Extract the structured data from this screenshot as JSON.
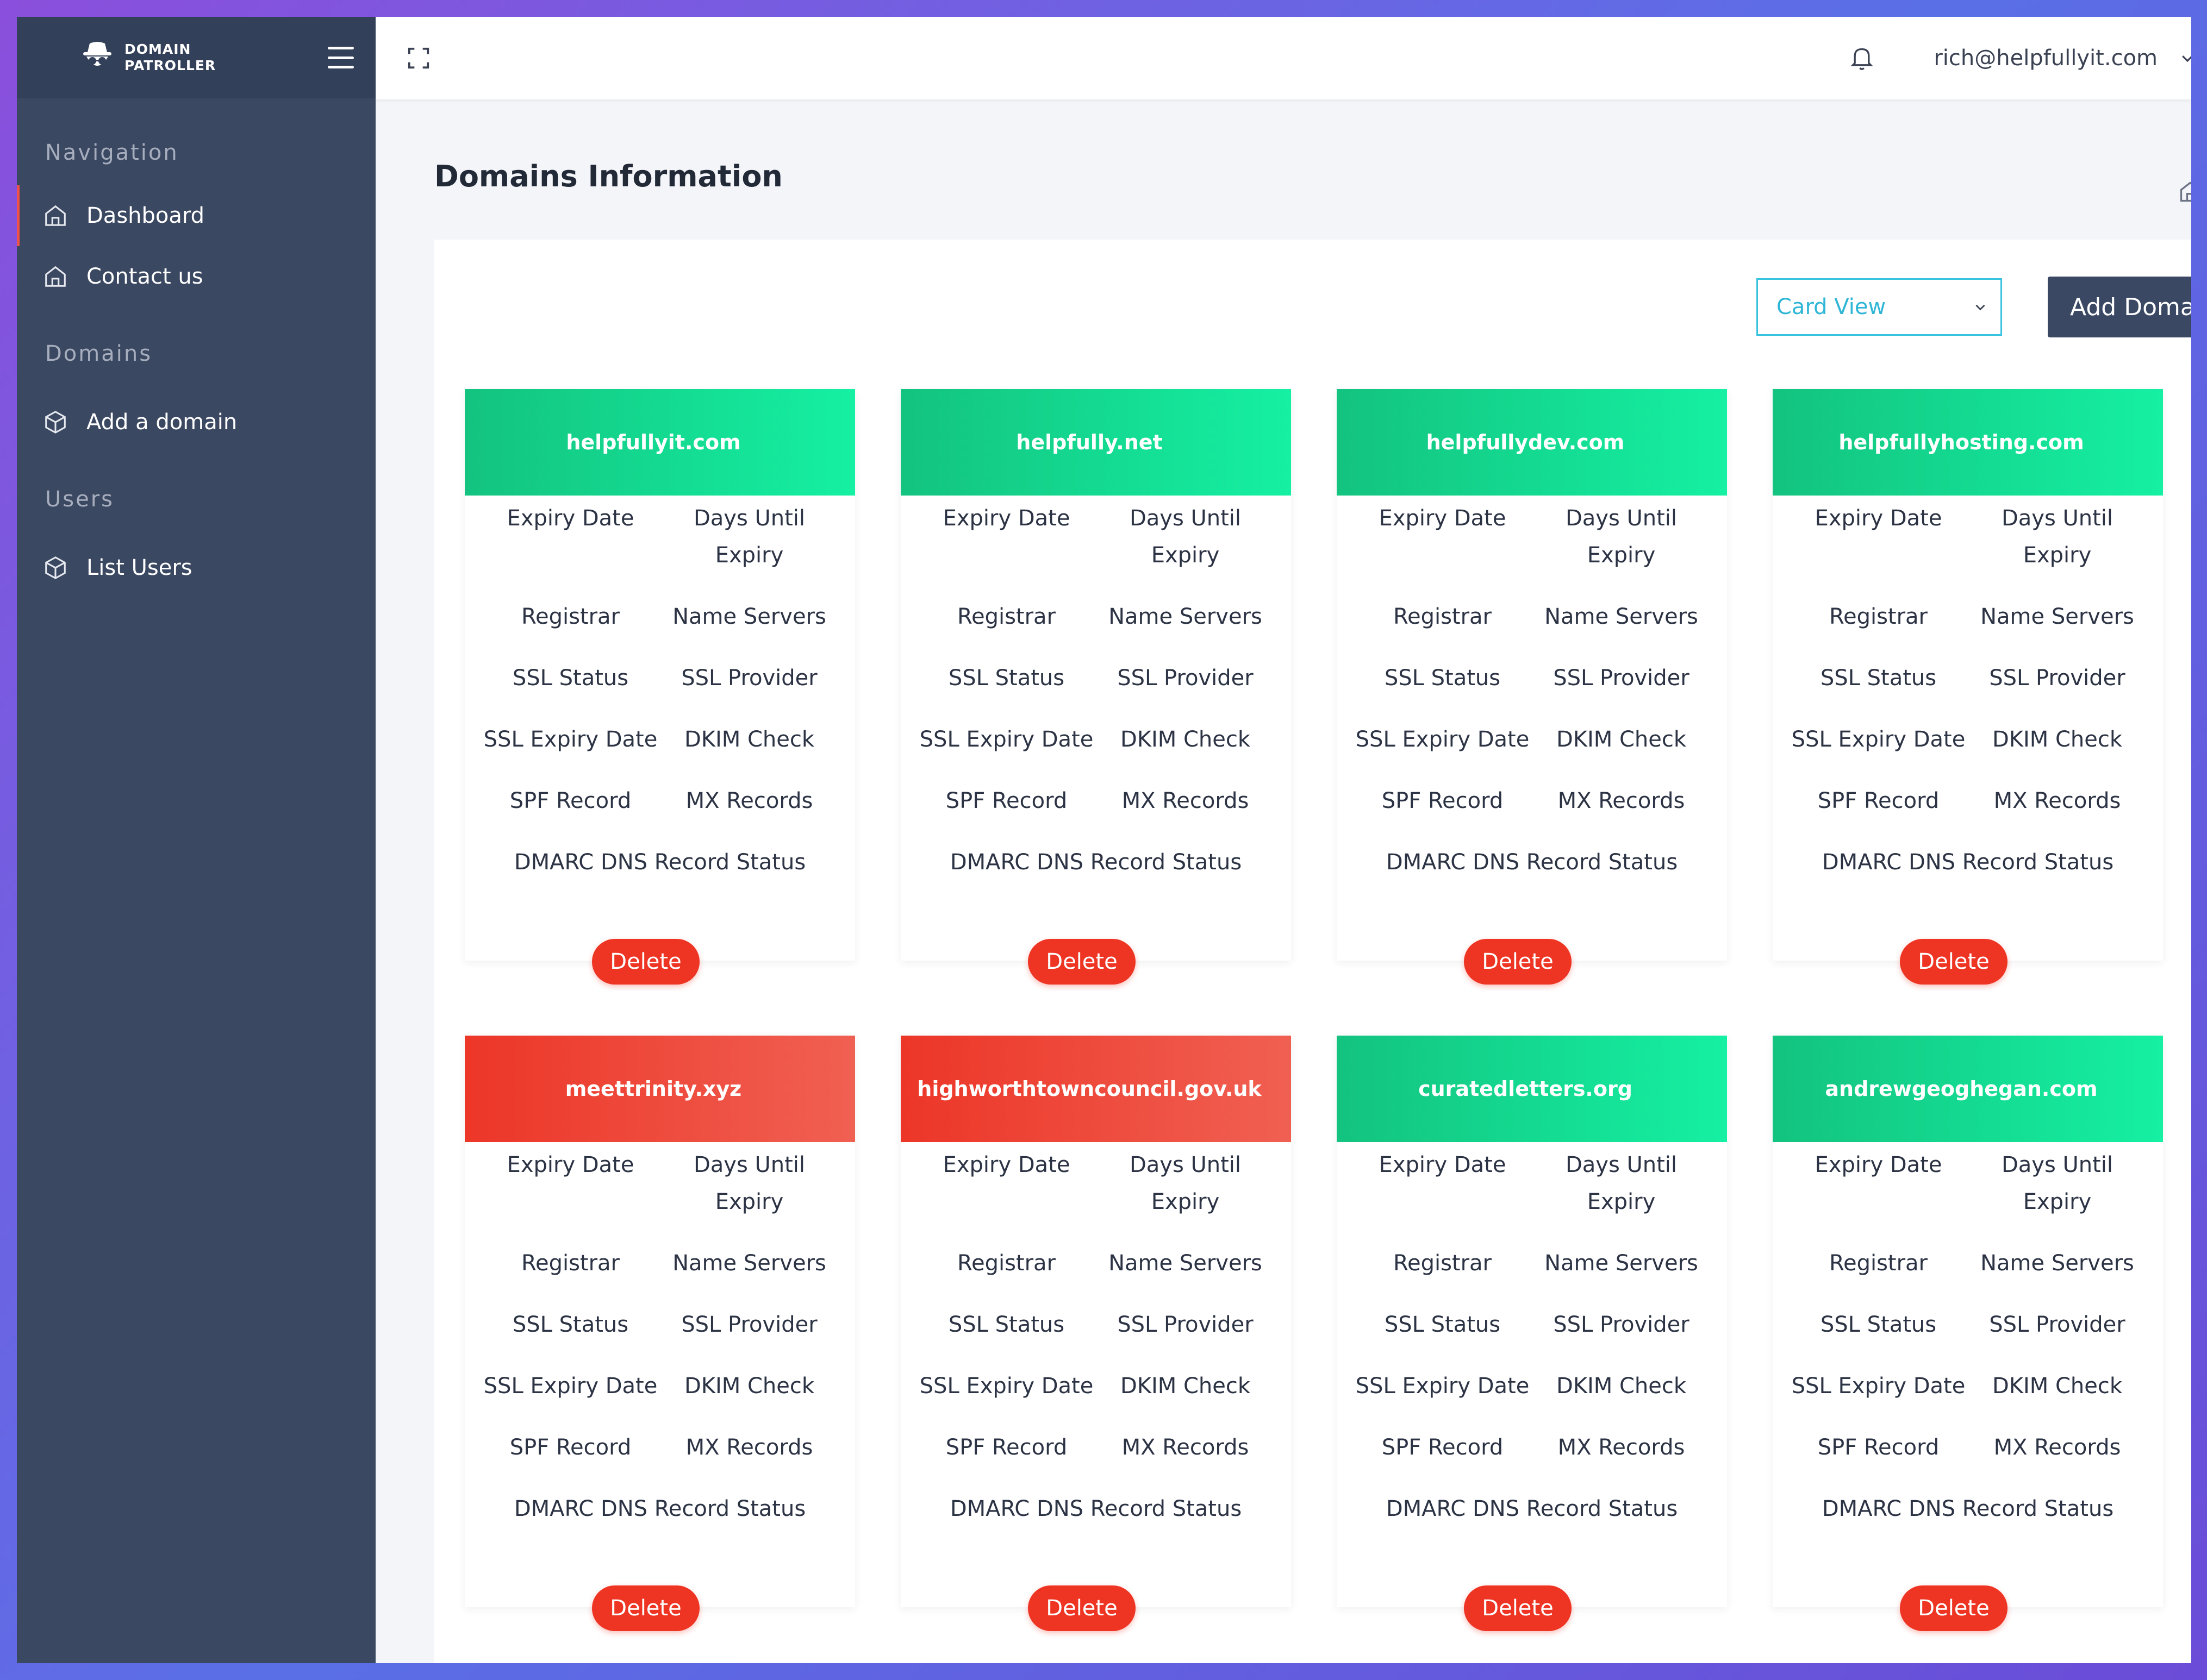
{
  "brand": {
    "line1": "DOMAIN",
    "line2": "PATROLLER"
  },
  "sidebar": {
    "sections": [
      {
        "title": "Navigation",
        "items": [
          {
            "label": "Dashboard"
          },
          {
            "label": "Contact us"
          }
        ]
      },
      {
        "title": "Domains",
        "items": [
          {
            "label": "Add a domain"
          }
        ]
      },
      {
        "title": "Users",
        "items": [
          {
            "label": "List Users"
          }
        ]
      }
    ]
  },
  "topbar": {
    "user_email": "rich@helpfullyit.com"
  },
  "page": {
    "title": "Domains Information"
  },
  "controls": {
    "view_select": "Card View",
    "add_button": "Add Domain"
  },
  "card_fields": {
    "expiry_date": "Expiry Date",
    "days_until_expiry": "Days Until Expiry",
    "registrar": "Registrar",
    "name_servers": "Name Servers",
    "ssl_status": "SSL Status",
    "ssl_provider": "SSL Provider",
    "ssl_expiry_date": "SSL Expiry Date",
    "dkim_check": "DKIM Check",
    "spf_record": "SPF Record",
    "mx_records": "MX Records",
    "dmarc_status": "DMARC DNS Record Status",
    "delete_label": "Delete"
  },
  "domains": [
    {
      "name": "helpfullyit.com",
      "status_color": "#13c37f"
    },
    {
      "name": "helpfully.net",
      "status_color": "#13c37f"
    },
    {
      "name": "helpfullydev.com",
      "status_color": "#13c37f"
    },
    {
      "name": "helpfullyhosting.com",
      "status_color": "#13c37f"
    },
    {
      "name": "meettrinity.xyz",
      "status_color": "#ec3628"
    },
    {
      "name": "highworthtowncouncil.gov.uk",
      "status_color": "#ec3628"
    },
    {
      "name": "curatedletters.org",
      "status_color": "#13c37f"
    },
    {
      "name": "andrewgeoghegan.com",
      "status_color": "#13c37f"
    }
  ],
  "colors": {
    "sidebar_bg": "#3b4862",
    "accent_green": "#15f0a2",
    "accent_red": "#ee3423",
    "active_indicator": "#f0514b",
    "select_border": "#37c3e0"
  }
}
